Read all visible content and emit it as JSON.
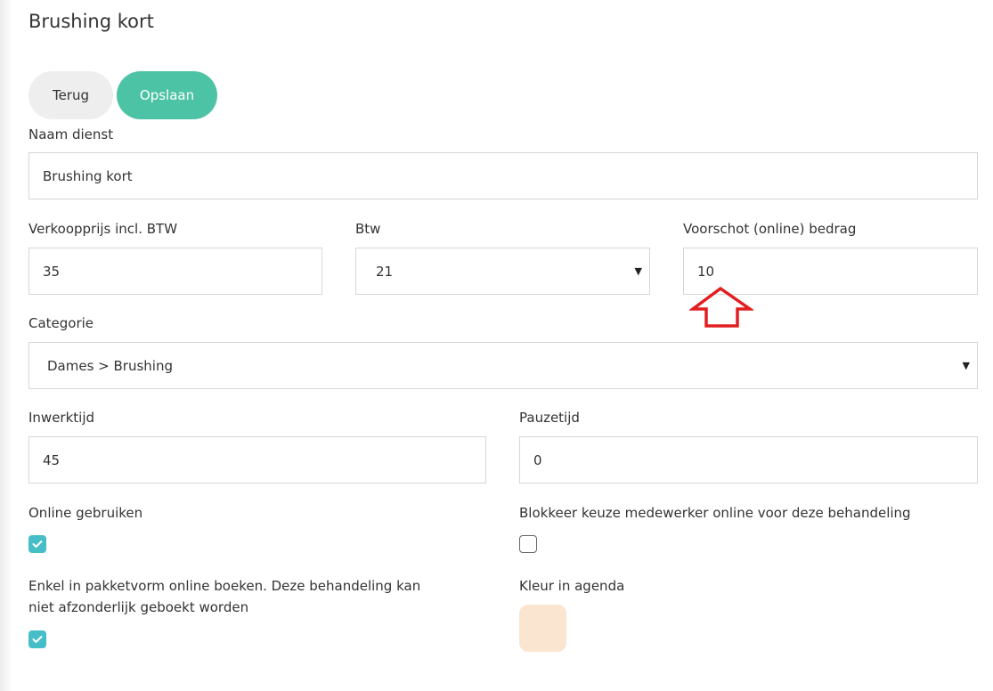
{
  "colors": {
    "accent": "#4dc3a5",
    "checkbox": "#45bec7",
    "annotation_arrow": "#e02020",
    "agenda_color": "#fae5d1"
  },
  "page": {
    "title": "Brushing kort"
  },
  "toolbar": {
    "back_label": "Terug",
    "save_label": "Opslaan"
  },
  "form": {
    "naam_dienst": {
      "label": "Naam dienst",
      "value": "Brushing kort"
    },
    "verkoopprijs": {
      "label": "Verkoopprijs incl. BTW",
      "value": "35"
    },
    "btw": {
      "label": "Btw",
      "value": "21",
      "icon": "caret-down-icon"
    },
    "voorschot": {
      "label": "Voorschot (online) bedrag",
      "value": "10"
    },
    "categorie": {
      "label": "Categorie",
      "value": "Dames > Brushing",
      "icon": "caret-down-icon"
    },
    "inwerktijd": {
      "label": "Inwerktijd",
      "value": "45"
    },
    "pauzetijd": {
      "label": "Pauzetijd",
      "value": "0"
    },
    "online_gebruiken": {
      "label": "Online gebruiken",
      "checked": true
    },
    "blokkeer_keuze": {
      "label": "Blokkeer keuze medewerker online voor deze behandeling",
      "checked": false
    },
    "enkel_pakketvorm": {
      "label": "Enkel in pakketvorm online boeken. Deze behandeling kan niet afzonderlijk geboekt worden",
      "checked": true
    },
    "kleur_agenda": {
      "label": "Kleur in agenda",
      "color": "#fae5d1"
    }
  },
  "annotation": {
    "icon": "up-arrow-outline-icon"
  }
}
